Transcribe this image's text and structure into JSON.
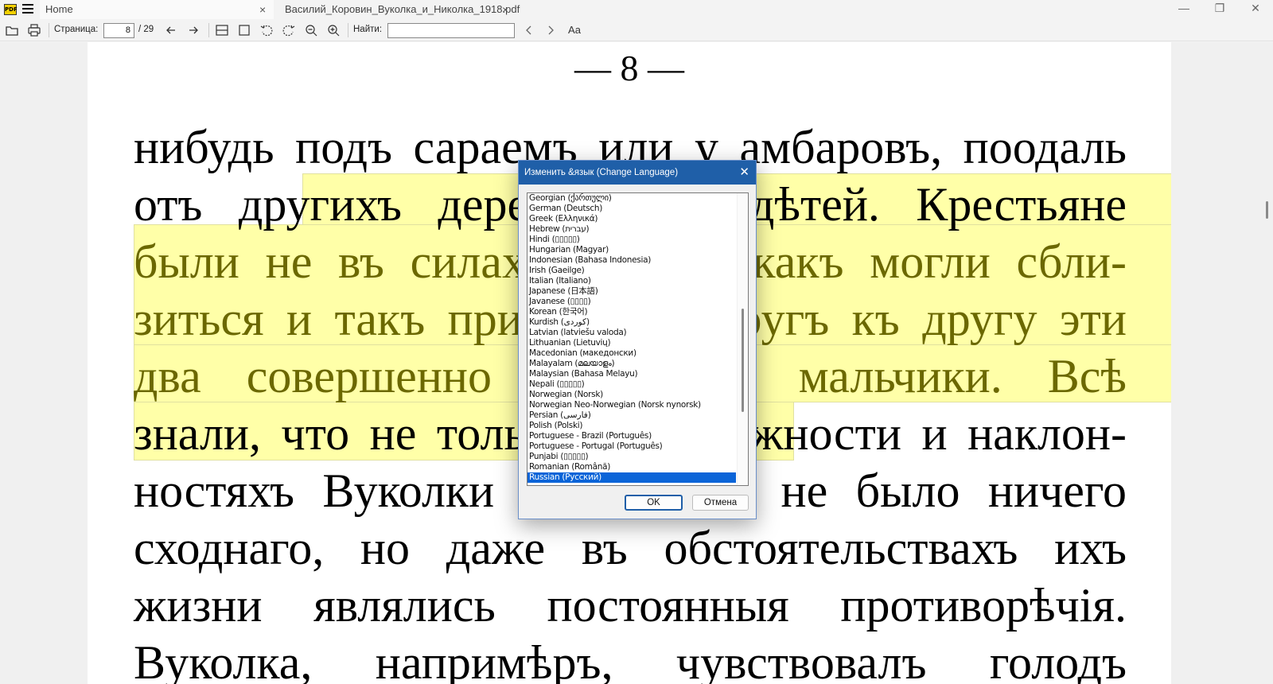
{
  "titlebar": {
    "logo_text": "PDF",
    "tabs": [
      {
        "label": "Home"
      },
      {
        "label": "Василий_Коровин_Вуколка_и_Николка_1918.pdf"
      }
    ],
    "close_glyph": "×",
    "window_controls": {
      "minimize": "—",
      "restore": "❐",
      "close": "✕"
    }
  },
  "toolbar": {
    "page_label": "Страница:",
    "page_value": "8",
    "page_total": "/ 29",
    "find_label": "Найти:",
    "find_value": "",
    "font_glyph": "Aa",
    "icons": [
      "open-folder-icon",
      "print-icon",
      "arrow-left-icon",
      "arrow-right-icon",
      "fit-width-icon",
      "fit-page-icon",
      "rotate-left-icon",
      "rotate-right-icon",
      "zoom-out-icon",
      "zoom-in-icon",
      "chevron-left-icon",
      "chevron-right-icon",
      "font-size-icon"
    ]
  },
  "document": {
    "page_number": "— 8 —",
    "lines": [
      "нибудь подъ сараемъ или у амбаровъ, поодаль",
      "отъ другихъ деревенскихъ дѣтей. Крестьяне",
      "были не въ силахъ понять, какъ могли сбли-",
      "зиться и такъ привязаться другъ къ другу эти",
      "два совершенно различные мальчики. Всѣ",
      "знали, что не только въ наружности и наклон-",
      "ностяхъ Вуколки и Николки не было ничего",
      "сходнаго, но даже въ обстоятельствахъ ихъ",
      "жизни являлись постоянныя противорѣчія.",
      "Вуколка, напримѣръ, чувствовалъ голодъ"
    ],
    "highlight_color": "#ffffa8"
  },
  "dialog": {
    "title": "Изменить &язык (Change Language)",
    "close_glyph": "✕",
    "languages": [
      "Georgian (ქართული)",
      "German (Deutsch)",
      "Greek (Ελληνικά)",
      "Hebrew (עברית)",
      "Hindi (▯▯▯▯▯)",
      "Hungarian (Magyar)",
      "Indonesian (Bahasa Indonesia)",
      "Irish (Gaeilge)",
      "Italian (Italiano)",
      "Japanese (日本語)",
      "Javanese (▯▯▯▯)",
      "Korean (한국어)",
      "Kurdish (کوردی)",
      "Latvian (latviešu valoda)",
      "Lithuanian (Lietuvių)",
      "Macedonian (македонски)",
      "Malayalam (മലയാളം)",
      "Malaysian (Bahasa Melayu)",
      "Nepali (▯▯▯▯▯)",
      "Norwegian (Norsk)",
      "Norwegian Neo-Norwegian (Norsk nynorsk)",
      "Persian (فارسی)",
      "Polish (Polski)",
      "Portuguese - Brazil (Português)",
      "Portuguese - Portugal (Português)",
      "Punjabi (▯▯▯▯▯)",
      "Romanian (Română)",
      "Russian (Русский)"
    ],
    "selected_language": "Russian (Русский)",
    "ok_label": "OK",
    "cancel_label": "Отмена"
  }
}
